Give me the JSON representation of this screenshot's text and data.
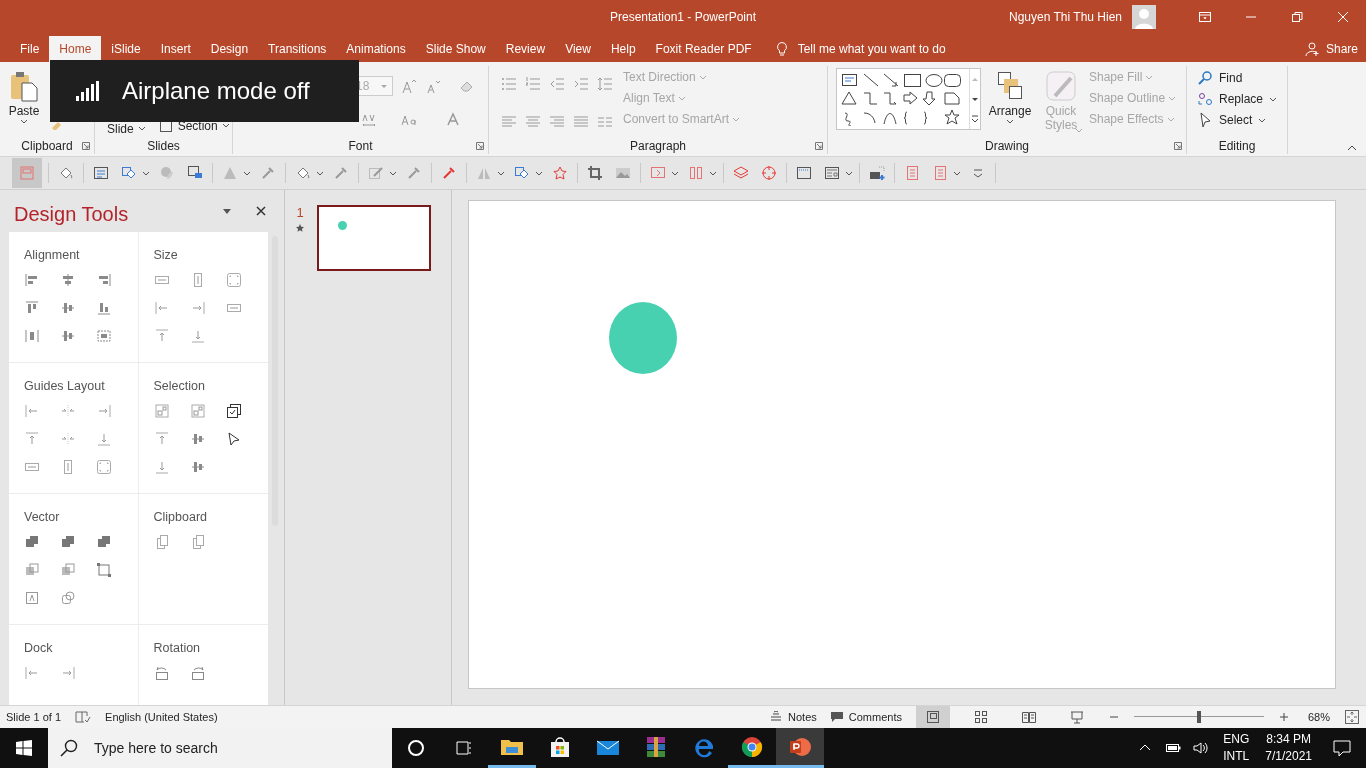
{
  "window": {
    "title": "Presentation1  -  PowerPoint",
    "user": "Nguyen Thi Thu Hien"
  },
  "tabs": [
    {
      "label": "File",
      "selected": false
    },
    {
      "label": "Home",
      "selected": true
    },
    {
      "label": "iSlide",
      "selected": false
    },
    {
      "label": "Insert",
      "selected": false
    },
    {
      "label": "Design",
      "selected": false
    },
    {
      "label": "Transitions",
      "selected": false
    },
    {
      "label": "Animations",
      "selected": false
    },
    {
      "label": "Slide Show",
      "selected": false
    },
    {
      "label": "Review",
      "selected": false
    },
    {
      "label": "View",
      "selected": false
    },
    {
      "label": "Help",
      "selected": false
    },
    {
      "label": "Foxit Reader PDF",
      "selected": false
    }
  ],
  "tell_me": "Tell me what you want to do",
  "share": "Share",
  "ribbon": {
    "clipboard": {
      "paste": "Paste",
      "label": "Clipboard"
    },
    "slides": {
      "new_slide": "Slide",
      "section": "Section",
      "label": "Slides"
    },
    "font": {
      "size": "18",
      "label": "Font"
    },
    "paragraph": {
      "label": "Paragraph",
      "commands": [
        {
          "label": "Text Direction",
          "disabled": true
        },
        {
          "label": "Align Text",
          "disabled": true
        },
        {
          "label": "Convert to SmartArt",
          "disabled": true
        }
      ]
    },
    "drawing": {
      "label": "Drawing",
      "arrange": "Arrange",
      "quick_styles": {
        "label": "Quick Styles",
        "disabled": true
      },
      "commands": [
        {
          "label": "Shape Fill",
          "disabled": true
        },
        {
          "label": "Shape Outline",
          "disabled": true
        },
        {
          "label": "Shape Effects",
          "disabled": true
        }
      ]
    },
    "editing": {
      "label": "Editing",
      "commands": [
        {
          "label": "Find",
          "disabled": false
        },
        {
          "label": "Replace",
          "disabled": false
        },
        {
          "label": "Select",
          "disabled": false
        }
      ]
    }
  },
  "toast": {
    "message": "Airplane mode off"
  },
  "design_tools": {
    "title": "Design Tools",
    "sections": [
      {
        "title": "Alignment"
      },
      {
        "title": "Size"
      },
      {
        "title": "Guides Layout"
      },
      {
        "title": "Selection"
      },
      {
        "title": "Vector"
      },
      {
        "title": "Clipboard"
      },
      {
        "title": "Dock"
      },
      {
        "title": "Rotation"
      }
    ]
  },
  "thumbnails": [
    {
      "number": "1",
      "selected": true
    }
  ],
  "slide": {
    "shapes": [
      {
        "kind": "circle",
        "color": "#48d1b0"
      }
    ]
  },
  "status_bar": {
    "slide": "Slide 1 of 1",
    "language": "English (United States)",
    "notes": "Notes",
    "comments": "Comments",
    "views": [
      {
        "selected": true
      },
      {
        "selected": false
      },
      {
        "selected": false
      },
      {
        "selected": false
      }
    ],
    "zoom": {
      "level": 0.5,
      "reading": "68%"
    }
  },
  "taskbar": {
    "search": {
      "placeholder": "Type here to search"
    },
    "apps": [
      {
        "kind": "folder",
        "running": true,
        "selected": false
      },
      {
        "kind": "store",
        "running": false,
        "selected": false
      },
      {
        "kind": "mail",
        "running": false,
        "selected": false
      },
      {
        "kind": "archive",
        "running": false,
        "selected": false
      },
      {
        "kind": "edge",
        "running": false,
        "selected": false
      },
      {
        "kind": "chrome",
        "running": true,
        "selected": false
      },
      {
        "kind": "powerpoint",
        "running": true,
        "selected": true
      }
    ],
    "language": "ENG",
    "layout": "INTL",
    "time": "8:34 PM",
    "date": "7/1/2021"
  }
}
